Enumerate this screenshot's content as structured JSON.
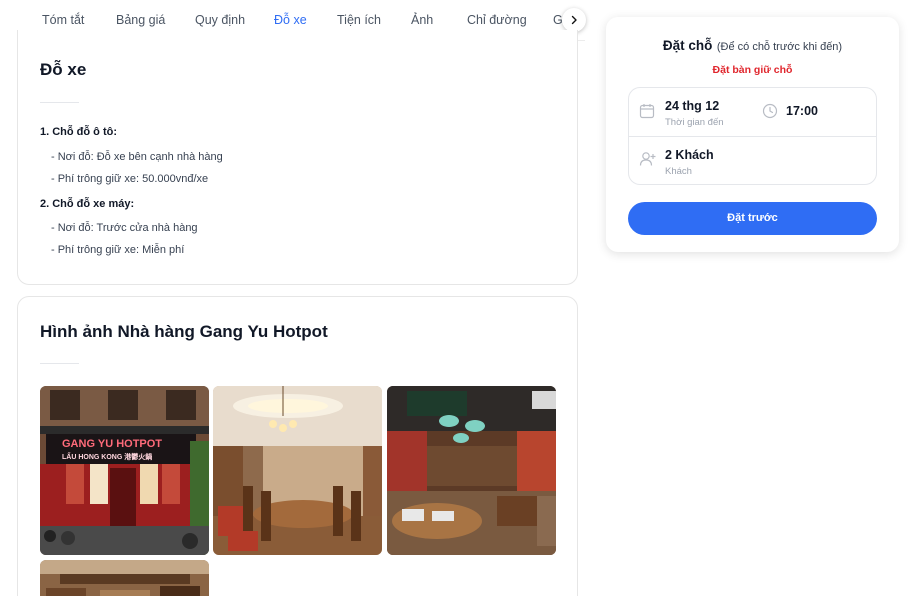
{
  "tabs": [
    {
      "label": "Tóm tắt",
      "active": false
    },
    {
      "label": "Bảng giá",
      "active": false
    },
    {
      "label": "Quy định",
      "active": false
    },
    {
      "label": "Đỗ xe",
      "active": true
    },
    {
      "label": "Tiện ích",
      "active": false
    },
    {
      "label": "Ảnh",
      "active": false
    },
    {
      "label": "Chỉ đường",
      "active": false
    },
    {
      "label": "Gi",
      "active": false
    }
  ],
  "parking": {
    "title": "Đỗ xe",
    "car_heading": "1. Chỗ đỗ ô tô:",
    "car_location": "- Nơi đỗ: Đỗ xe bên cạnh nhà hàng",
    "car_fee": "- Phí trông giữ xe: 50.000vnđ/xe",
    "bike_heading": "2. Chỗ đỗ xe máy:",
    "bike_location": "- Nơi đỗ: Trước cửa nhà hàng",
    "bike_fee": "- Phí trông giữ xe: Miễn phí"
  },
  "gallery": {
    "title": "Hình ảnh Nhà hàng Gang Yu Hotpot",
    "storefront_sign_1": "GANG YU HOTPOT",
    "storefront_sign_2": "LẨU HONG KONG 港鬱火鍋"
  },
  "booking": {
    "title": "Đặt chỗ",
    "note": "(Để có chỗ trước khi đến)",
    "hold_label": "Đặt bàn giữ chỗ",
    "date_value": "24 thg 12",
    "date_label": "Thời gian đến",
    "time_value": "17:00",
    "guests_value": "2 Khách",
    "guests_label": "Khách",
    "submit_label": "Đặt trước"
  },
  "colors": {
    "accent": "#2f6df4",
    "hold_red": "#e0262d"
  }
}
